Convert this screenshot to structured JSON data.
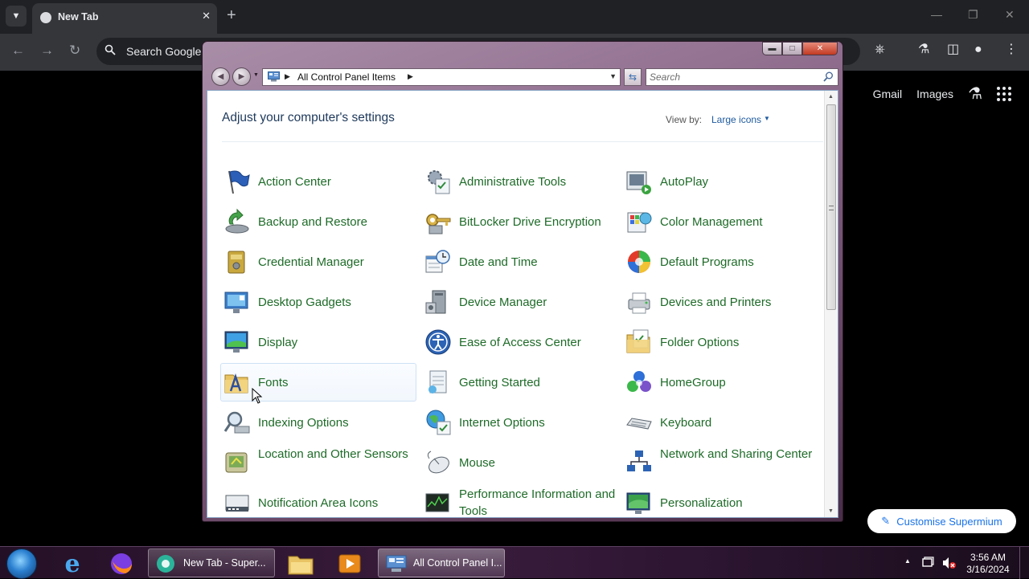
{
  "browser": {
    "tab_title": "New Tab",
    "omnibox_text": "Search Google",
    "ntp_links": {
      "gmail": "Gmail",
      "images": "Images"
    },
    "customise_label": "Customise Supermium"
  },
  "control_panel": {
    "address": "All Control Panel Items",
    "search_placeholder": "Search",
    "heading": "Adjust your computer's settings",
    "view_by_label": "View by:",
    "view_by_value": "Large icons",
    "items": [
      {
        "label": "Action Center",
        "icon": "flag-icon"
      },
      {
        "label": "Administrative Tools",
        "icon": "admin-tools-icon"
      },
      {
        "label": "AutoPlay",
        "icon": "autoplay-icon"
      },
      {
        "label": "Backup and Restore",
        "icon": "backup-icon"
      },
      {
        "label": "BitLocker Drive Encryption",
        "icon": "bitlocker-icon"
      },
      {
        "label": "Color Management",
        "icon": "color-management-icon"
      },
      {
        "label": "Credential Manager",
        "icon": "credential-icon"
      },
      {
        "label": "Date and Time",
        "icon": "date-time-icon"
      },
      {
        "label": "Default Programs",
        "icon": "default-programs-icon"
      },
      {
        "label": "Desktop Gadgets",
        "icon": "gadgets-icon"
      },
      {
        "label": "Device Manager",
        "icon": "device-manager-icon"
      },
      {
        "label": "Devices and Printers",
        "icon": "printer-icon"
      },
      {
        "label": "Display",
        "icon": "display-icon"
      },
      {
        "label": "Ease of Access Center",
        "icon": "ease-of-access-icon"
      },
      {
        "label": "Folder Options",
        "icon": "folder-options-icon"
      },
      {
        "label": "Fonts",
        "icon": "fonts-icon"
      },
      {
        "label": "Getting Started",
        "icon": "getting-started-icon"
      },
      {
        "label": "HomeGroup",
        "icon": "homegroup-icon"
      },
      {
        "label": "Indexing Options",
        "icon": "indexing-icon"
      },
      {
        "label": "Internet Options",
        "icon": "internet-options-icon"
      },
      {
        "label": "Keyboard",
        "icon": "keyboard-icon"
      },
      {
        "label": "Location and Other Sensors",
        "icon": "sensors-icon"
      },
      {
        "label": "Mouse",
        "icon": "mouse-icon"
      },
      {
        "label": "Network and Sharing Center",
        "icon": "network-icon"
      },
      {
        "label": "Notification Area Icons",
        "icon": "notification-icon"
      },
      {
        "label": "Performance Information and Tools",
        "icon": "performance-icon"
      },
      {
        "label": "Personalization",
        "icon": "personalization-icon"
      }
    ]
  },
  "taskbar": {
    "tasks": [
      {
        "label": "New Tab - Super..."
      },
      {
        "label": "All Control Panel I..."
      }
    ],
    "clock_time": "3:56 AM",
    "clock_date": "3/16/2024"
  },
  "colors": {
    "item_link": "#1e6b28",
    "heading": "#1e395b",
    "window_frame": "#8f6c8d",
    "chrome_dark": "#202124"
  }
}
